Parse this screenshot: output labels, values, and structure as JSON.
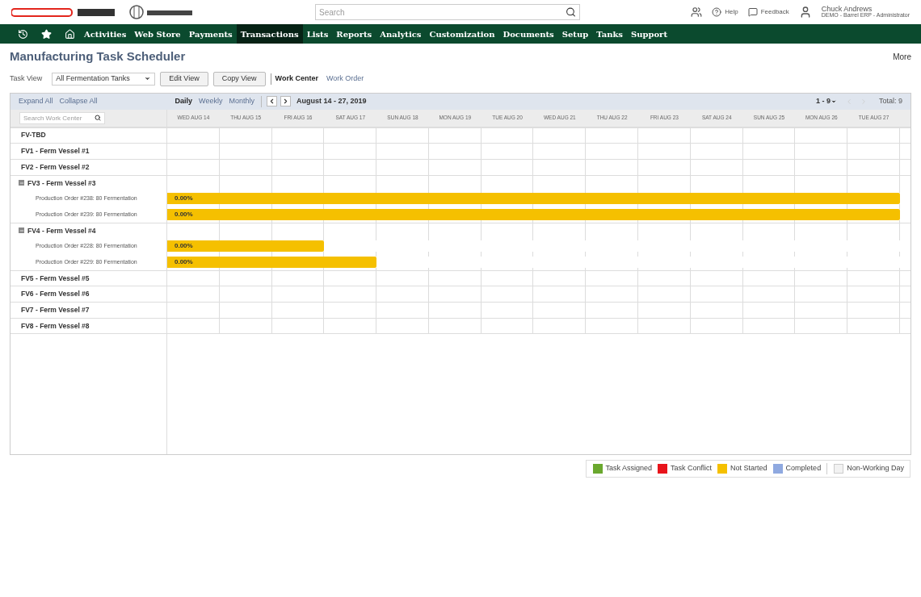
{
  "header": {
    "search": {
      "placeholder": "Search"
    },
    "help": "Help",
    "feedback": "Feedback",
    "user": {
      "name": "Chuck Andrews",
      "role": "DEMO - Barrel ERP - Administrator"
    }
  },
  "nav": [
    {
      "label": "Activities",
      "selected": false
    },
    {
      "label": "Web Store",
      "selected": false
    },
    {
      "label": "Payments",
      "selected": false
    },
    {
      "label": "Transactions",
      "selected": true
    },
    {
      "label": "Lists",
      "selected": false
    },
    {
      "label": "Reports",
      "selected": false
    },
    {
      "label": "Analytics",
      "selected": false
    },
    {
      "label": "Customization",
      "selected": false
    },
    {
      "label": "Documents",
      "selected": false
    },
    {
      "label": "Setup",
      "selected": false
    },
    {
      "label": "Tanks",
      "selected": false
    },
    {
      "label": "Support",
      "selected": false
    }
  ],
  "page": {
    "title": "Manufacturing Task Scheduler",
    "more": "More"
  },
  "task_view": {
    "label": "Task View",
    "value": "All Fermentation Tanks",
    "buttons": [
      "Edit View",
      "Copy View"
    ],
    "tabs": [
      {
        "label": "Work Center",
        "selected": true
      },
      {
        "label": "Work Order",
        "selected": false
      }
    ]
  },
  "toolbar": {
    "expand": "Expand All",
    "collapse": "Collapse All",
    "modes": [
      {
        "label": "Daily",
        "selected": true
      },
      {
        "label": "Weekly",
        "selected": false
      },
      {
        "label": "Monthly",
        "selected": false
      }
    ],
    "range": "August 14 - 27, 2019",
    "paging": "1 - 9",
    "total": "Total: 9"
  },
  "search": {
    "placeholder": "Search Work Center"
  },
  "days": [
    "WED AUG 14",
    "THU AUG 15",
    "FRI AUG 16",
    "SAT AUG 17",
    "SUN AUG 18",
    "MON AUG 19",
    "TUE AUG 20",
    "WED AUG 21",
    "THU AUG 22",
    "FRI AUG 23",
    "SAT AUG 24",
    "SUN AUG 25",
    "MON AUG 26",
    "TUE AUG 27"
  ],
  "centers": [
    {
      "name": "FV-TBD"
    },
    {
      "name": "FV1 - Ferm Vessel #1"
    },
    {
      "name": "FV2 - Ferm Vessel #2"
    },
    {
      "name": "FV3 - Ferm Vessel #3",
      "expanded": true,
      "children": [
        {
          "name": "Production Order #238: 80 Fermentation",
          "bar": "0.00%",
          "level": 1
        },
        {
          "name": "Production Order #239: 80 Fermentation",
          "bar": "0.00%",
          "level": 1
        }
      ]
    },
    {
      "name": "FV4 - Ferm Vessel #4",
      "expanded": true,
      "children": [
        {
          "name": "Production Order #228: 80 Fermentation",
          "bar": "0.00%",
          "level": 0.2143
        },
        {
          "name": "Production Order #229: 80 Fermentation",
          "bar": "0.00%",
          "level": 0.2857
        }
      ]
    },
    {
      "name": "FV5 - Ferm Vessel #5"
    },
    {
      "name": "FV6 - Ferm Vessel #6"
    },
    {
      "name": "FV7 - Ferm Vessel #7"
    },
    {
      "name": "FV8 - Ferm Vessel #8"
    }
  ],
  "legend": [
    {
      "label": "Task Assigned",
      "color": "#6aa82e"
    },
    {
      "label": "Task Conflict",
      "color": "#e8141b"
    },
    {
      "label": "Not Started",
      "color": "#f5c000"
    },
    {
      "label": "Completed",
      "color": "#8fa9e0"
    },
    {
      "label": "Non-Working Day",
      "color": "#f2f2f2"
    }
  ]
}
